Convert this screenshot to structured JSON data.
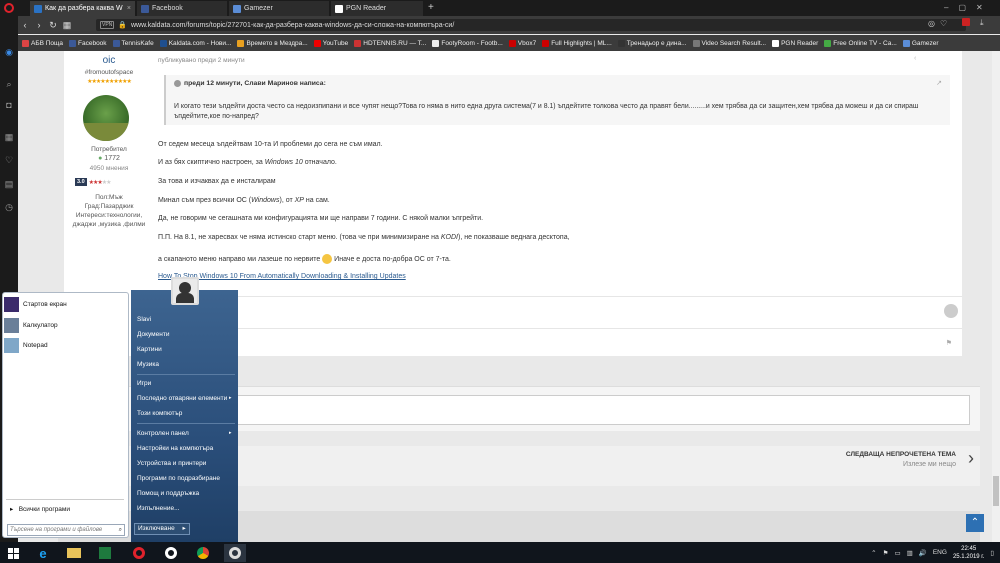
{
  "browser": {
    "tabs": [
      {
        "label": "Как да разбера каква W",
        "fav_color": "#2a72c4",
        "active": true
      },
      {
        "label": "Facebook",
        "fav_color": "#3b5998",
        "active": false
      },
      {
        "label": "Gamezer",
        "fav_color": "#5b8dd6",
        "active": false
      },
      {
        "label": "PGN Reader",
        "fav_color": "#ffffff",
        "active": false
      }
    ],
    "new_tab": "+",
    "vpn_label": "VPN",
    "url": "www.kaldata.com/forums/topic/272701-как-да-разбера-каква-windows-да-си-сложа-на-компютъра-си/",
    "bookmarks": [
      {
        "label": "АБВ Поща",
        "color": "#d44"
      },
      {
        "label": "Facebook",
        "color": "#3b5998"
      },
      {
        "label": "TennisKafe",
        "color": "#3b5998"
      },
      {
        "label": "Kaldata.com - Нови...",
        "color": "#1f4f8f"
      },
      {
        "label": "Времето в Мездра...",
        "color": "#e8a020"
      },
      {
        "label": "YouTube",
        "color": "#e00"
      },
      {
        "label": "HDTENNIS.RU — T...",
        "color": "#c33"
      },
      {
        "label": "FootyRoom - Footb...",
        "color": "#eee"
      },
      {
        "label": "Vbox7",
        "color": "#c00"
      },
      {
        "label": "Full Highlights | ML...",
        "color": "#c00"
      },
      {
        "label": "Тренадьор е дина...",
        "color": "#333"
      },
      {
        "label": "Video Search Result...",
        "color": "#777"
      },
      {
        "label": "PGN Reader",
        "color": "#fff"
      },
      {
        "label": "Free Online TV - Са...",
        "color": "#4a4"
      },
      {
        "label": "Gamezer",
        "color": "#5b8dd6"
      }
    ]
  },
  "author": {
    "username": "oic",
    "tagline": "#fromoutofspace",
    "stars": "★★★★★★★★★★",
    "group": "Потребител",
    "reputation": "1772",
    "posts": "4950 мнения",
    "rating_value": "3.0",
    "rating_stars": "★★★★★",
    "gender": "Пол:Мъж",
    "city": "Град:Пазарджик",
    "interests": "Интереси:технологии, джаджи ,музика ,филми"
  },
  "post": {
    "published": "публикувано преди 2 минути",
    "quote_header": "преди 12 минути, Слави Маринов написа:",
    "quote_body": "И когато тези ъпдейти доста често са недоизпипани и все чупят нещо?Това го няма в нито една друга система(7 и 8.1) ъпдейтите толкова често да правят бели.........и хем трябва да си защитен,хем трябва да можеш и да си спираш ъпдейтите,кое по-напред?",
    "line1": "От седем месеца ъпдейтвам 10-та И проблеми до сега не съм имал.",
    "line2": "И аз бях скиптично настроен, за Windows 10 отначало.",
    "line3": "За това и изчаквах да е инсталирам",
    "line4": "Минал съм през всички ОС (Windows), от XP на сам.",
    "line5": "Да, не говорим че сегашната ми конфигурацията ми ще направи 7 години. С някой малки ъпгрейти.",
    "line6": "П.П. На 8.1, не харесвах че няма истинско старт меню. (това че при минимизиране на KODI), не показваше веднага десктопа,",
    "line7a": "а скапаното меню направо ми лазеше по нервите",
    "line7b": "Иначе е доста по-добра ОС от 7-та.",
    "link": "How To Stop Windows 10 From Automatically Downloading & Installing Updates"
  },
  "next_topic": {
    "title": "СЛЕДВАЩА НЕПРОЧЕТЕНА ТЕМА",
    "subtitle": "Излезе ми нещо"
  },
  "start_menu": {
    "pinned": [
      {
        "label": "Стартов екран"
      },
      {
        "label": "Калкулатор"
      },
      {
        "label": "Notepad"
      }
    ],
    "all_programs": "Всички програми",
    "search_placeholder": "Търсене на програми и файлове",
    "right_items": [
      {
        "label": "Slavi",
        "has_arrow": false
      },
      {
        "label": "Документи",
        "has_arrow": false
      },
      {
        "label": "Картини",
        "has_arrow": false
      },
      {
        "label": "Музика",
        "has_arrow": false
      },
      {
        "label": "Игри",
        "has_arrow": false
      },
      {
        "label": "Последно отваряни елементи",
        "has_arrow": true
      },
      {
        "label": "Този компютър",
        "has_arrow": false
      },
      {
        "label": "Контролен панел",
        "has_arrow": true
      },
      {
        "label": "Настройки на компютъра",
        "has_arrow": false
      },
      {
        "label": "Устройства и принтери",
        "has_arrow": false
      },
      {
        "label": "Програми по подразбиране",
        "has_arrow": false
      },
      {
        "label": "Помощ и поддръжка",
        "has_arrow": false
      },
      {
        "label": "Изпълнение...",
        "has_arrow": false
      }
    ],
    "shutdown_label": "Изключване",
    "shutdown_arrow": "▸"
  },
  "taskbar": {
    "tray_lang": "ENG",
    "time": "22:45",
    "date": "25.1.2019 г."
  }
}
